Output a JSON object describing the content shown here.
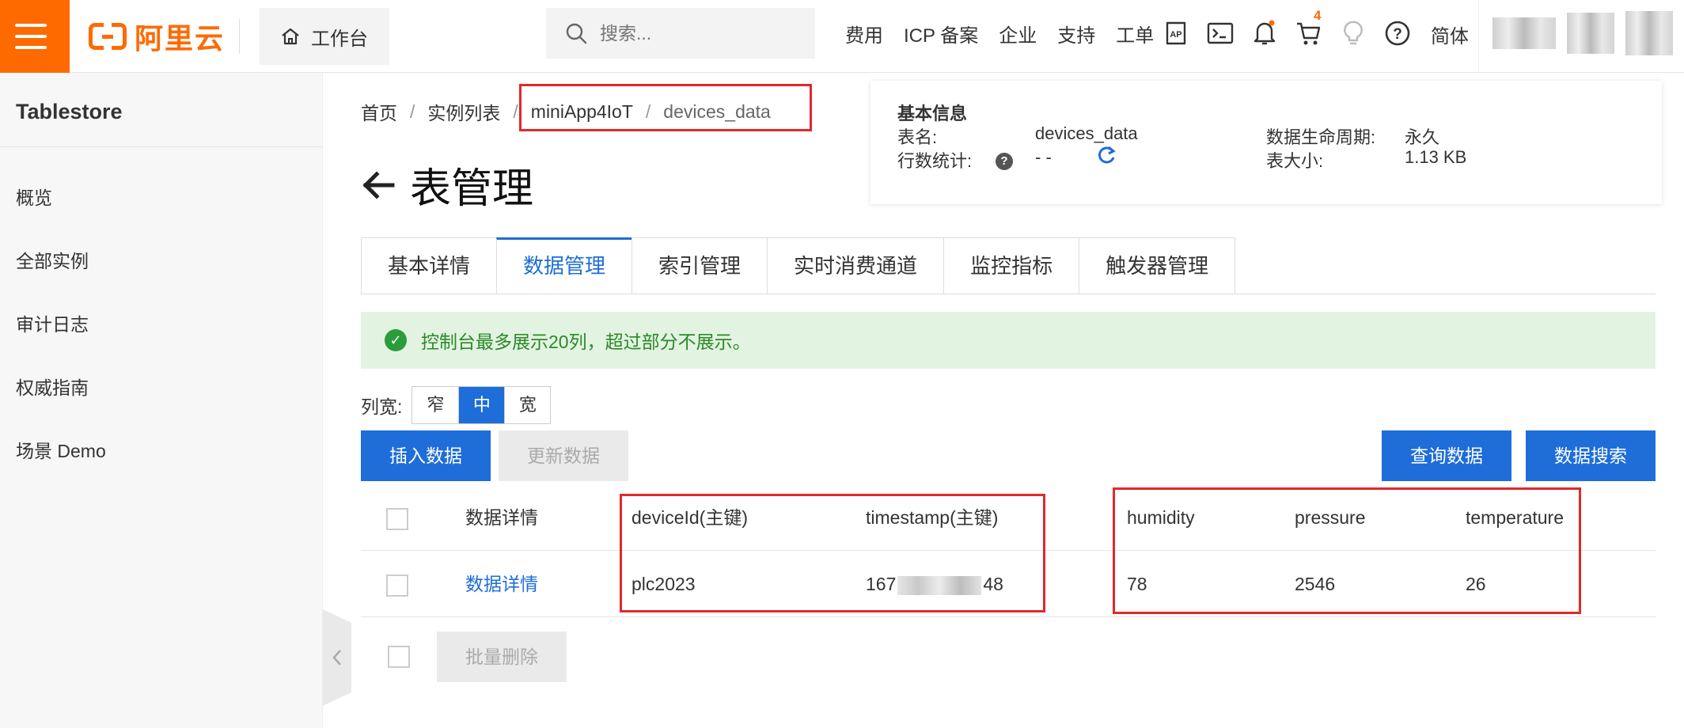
{
  "topbar": {
    "brand": "阿里云",
    "workbench_label": "工作台",
    "search_placeholder": "搜索...",
    "links": [
      "费用",
      "ICP 备案",
      "企业",
      "支持",
      "工单"
    ],
    "cart_count": "4",
    "language": "简体",
    "accent_color": "#ff6a00"
  },
  "sidebar": {
    "title": "Tablestore",
    "items": [
      "概览",
      "全部实例",
      "审计日志",
      "权威指南",
      "场景 Demo"
    ]
  },
  "breadcrumb": {
    "items": [
      "首页",
      "实例列表",
      "miniApp4IoT",
      "devices_data"
    ],
    "separator": "/"
  },
  "page": {
    "title": "表管理"
  },
  "info_card": {
    "heading": "基本信息",
    "table_name_label": "表名:",
    "table_name": "devices_data",
    "row_count_label": "行数统计:",
    "row_count": "- -",
    "lifecycle_label": "数据生命周期:",
    "lifecycle": "永久",
    "size_label": "表大小:",
    "size": "1.13 KB"
  },
  "tabs": {
    "items": [
      "基本详情",
      "数据管理",
      "索引管理",
      "实时消费通道",
      "监控指标",
      "触发器管理"
    ],
    "active": "数据管理"
  },
  "notice": {
    "text": "控制台最多展示20列，超过部分不展示。"
  },
  "column_width": {
    "label": "列宽:",
    "options": [
      "窄",
      "中",
      "宽"
    ],
    "selected": "中"
  },
  "actions": {
    "insert": "插入数据",
    "update": "更新数据",
    "query": "查询数据",
    "search": "数据搜索",
    "batch_delete": "批量删除"
  },
  "table": {
    "headers": [
      "数据详情",
      "deviceId(主键)",
      "timestamp(主键)",
      "humidity",
      "pressure",
      "temperature"
    ],
    "rows": [
      {
        "detail_link": "数据详情",
        "deviceId": "plc2023",
        "timestamp_prefix": "167",
        "timestamp_suffix": "48",
        "humidity": "78",
        "pressure": "2546",
        "temperature": "26"
      }
    ]
  }
}
